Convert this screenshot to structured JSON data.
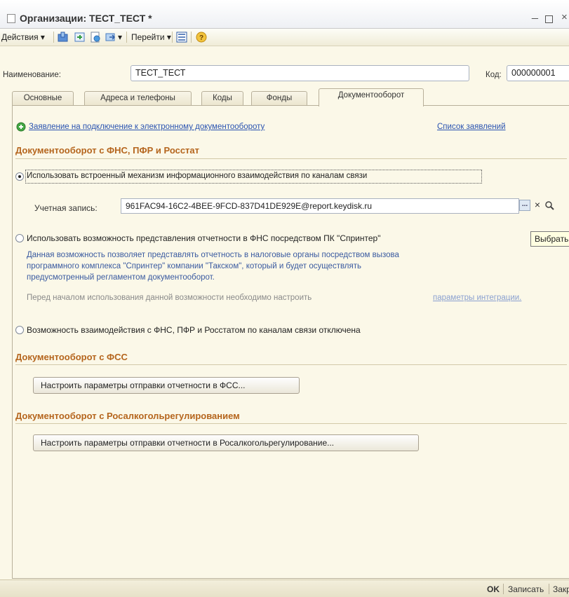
{
  "window": {
    "title": "Организации: ТЕСТ_ТЕСТ *",
    "minimize": "_",
    "close": "×"
  },
  "toolbar": {
    "actions_label": "Действия ▾",
    "goto_label": "Перейти ▾",
    "help_symbol": "?"
  },
  "header": {
    "name_label": "Наименование:",
    "name_value": "ТЕСТ_ТЕСТ",
    "code_label": "Код:",
    "code_value": "000000001"
  },
  "tabs": [
    {
      "label": "Основные"
    },
    {
      "label": "Адреса и телефоны"
    },
    {
      "label": "Коды"
    },
    {
      "label": "Фонды"
    },
    {
      "label": "Документооборот",
      "active": true
    }
  ],
  "docflow": {
    "connect_link": "Заявление на подключение к электронному документообороту",
    "list_link": "Список заявлений",
    "fns_section_title": "Документооборот с ФНС, ПФР и Росстат",
    "option_builtin": "Использовать встроенный механизм информационного взаимодействия по каналам связи",
    "account_label": "Учетная запись:",
    "account_value": "961FAC94-16C2-4BEE-9FCD-837D41DE929E@report.keydisk.ru",
    "select_btn": "...",
    "clear_btn": "×",
    "option_sprinter": "Использовать возможность представления отчетности в ФНС посредством ПК \"Спринтер\"",
    "sprinter_desc_1": "Данная возможность позволяет представлять отчетность в налоговые органы посредством вызова",
    "sprinter_desc_2": "программного комплекса \"Спринтер\" компании \"Такском\", который и будет осуществлять",
    "sprinter_desc_3": "предусмотренный регламентом документооборот.",
    "sprinter_hint": "Перед началом использования данной возможности необходимо настроить",
    "sprinter_hint_link": "параметры интеграции.",
    "option_disabled": "Возможность взаимодействия с ФНС, ПФР и Росстатом по каналам связи отключена",
    "fss_section_title": "Документооборот с ФСС",
    "fss_button": "Настроить параметры отправки отчетности в ФСС...",
    "rar_section_title": "Документооборот с Росалкогольрегулированием",
    "rar_button": "Настроить параметры отправки отчетности в Росалкогольрегулирование...",
    "selected_option": "builtin"
  },
  "tooltip": {
    "text": "Выбрать"
  },
  "bottom": {
    "ok": "OK",
    "save": "Записать",
    "close": "Закрыть"
  },
  "colors": {
    "section_title": "#b5651d",
    "link": "#2a53b0",
    "description": "#3a5aa0",
    "panel_bg": "#fbf8e8"
  }
}
